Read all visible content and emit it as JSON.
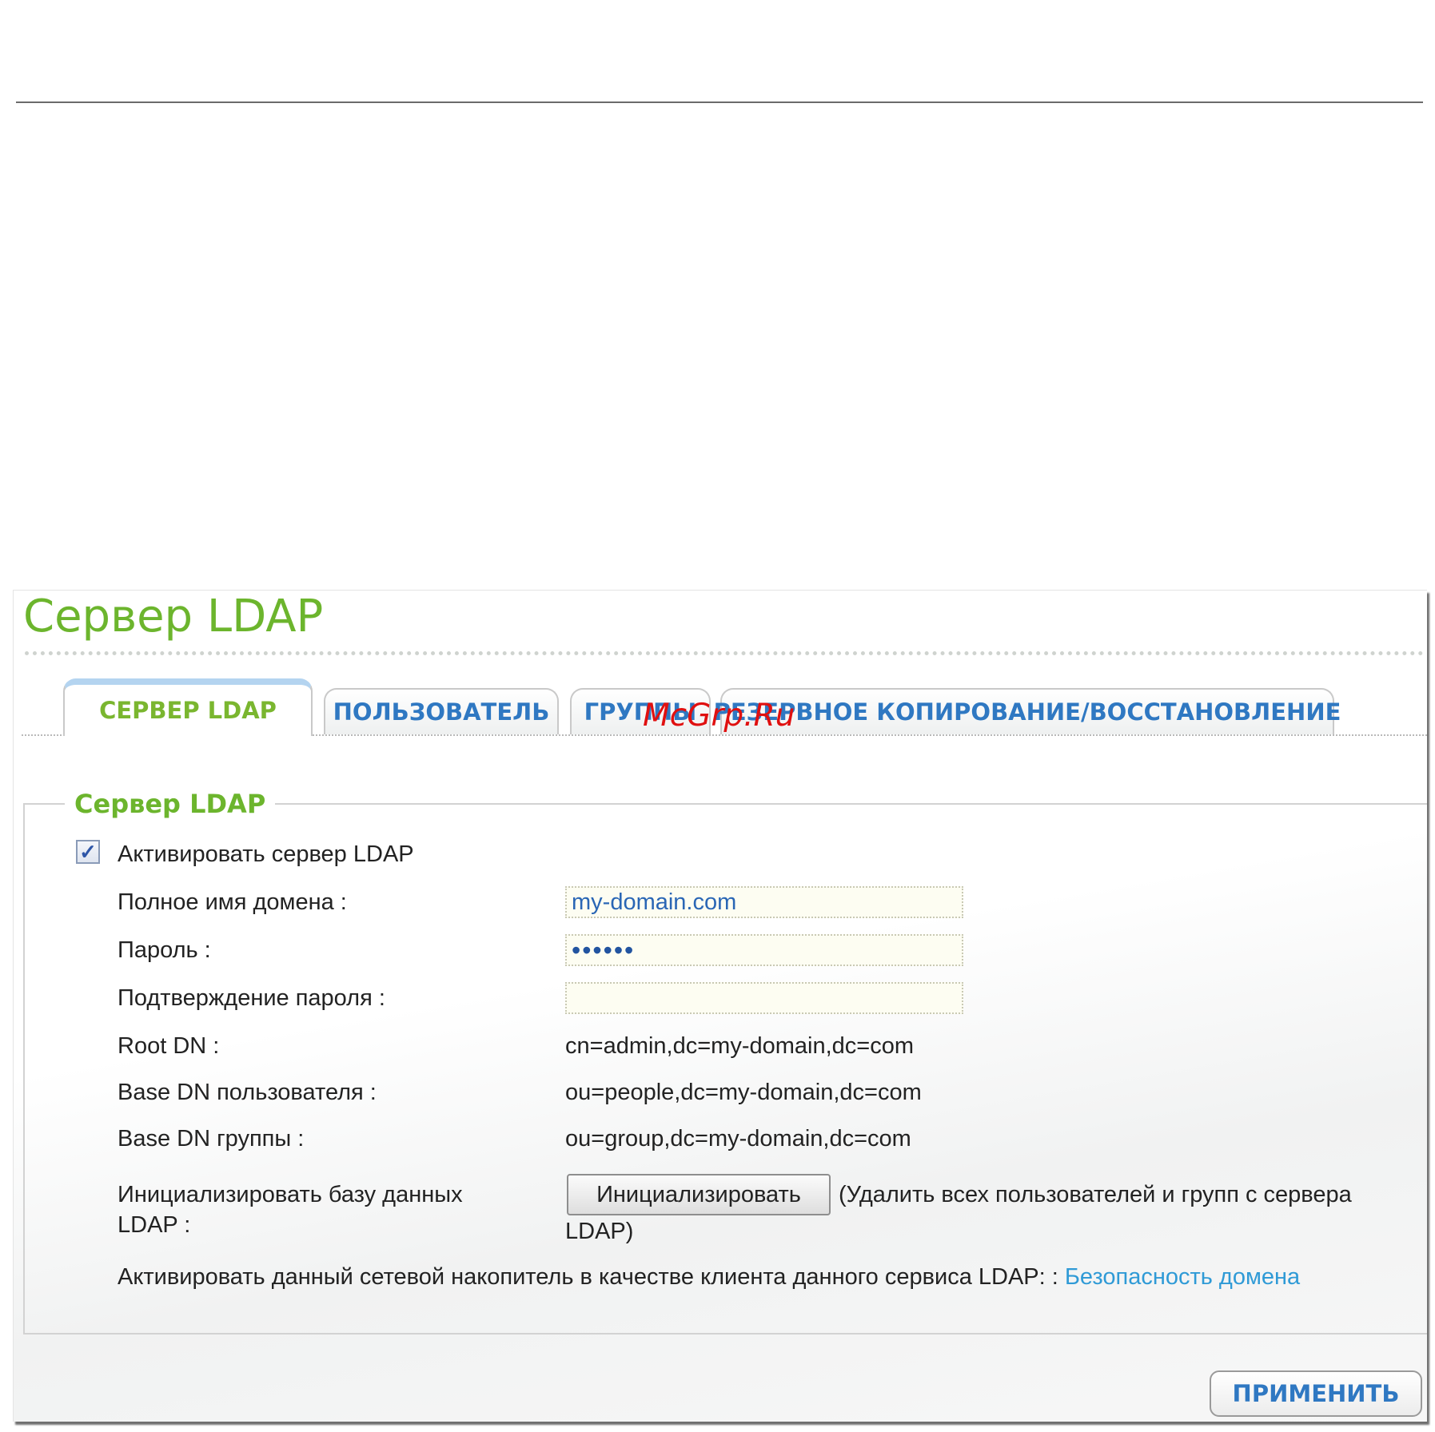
{
  "page": {
    "title": "Сервер LDAP",
    "watermark": "McGrp.Ru"
  },
  "tabs": [
    {
      "label": "СЕРВЕР LDAP",
      "active": true
    },
    {
      "label": "ПОЛЬЗОВАТЕЛЬ",
      "active": false
    },
    {
      "label": "ГРУППЫ",
      "active": false
    },
    {
      "label": "РЕЗЕРВНОЕ КОПИРОВАНИЕ/ВОССТАНОВЛЕНИЕ",
      "active": false
    }
  ],
  "section": {
    "legend": "Сервер LDAP",
    "enable_label": "Активировать сервер LDAP",
    "enable_checked": true,
    "domain_label": "Полное имя домена :",
    "domain_value": "my-domain.com",
    "password_label": "Пароль :",
    "password_value": "••••••",
    "confirm_label": "Подтверждение пароля :",
    "confirm_value": "",
    "rootdn_label": "Root DN :",
    "rootdn_value": "cn=admin,dc=my-domain,dc=com",
    "userdn_label": "Base DN пользователя :",
    "userdn_value": "ou=people,dc=my-domain,dc=com",
    "groupdn_label": "Base DN группы :",
    "groupdn_value": "ou=group,dc=my-domain,dc=com",
    "init_label_line1": "Инициализировать базу данных",
    "init_label_line2": "LDAP :",
    "init_button": "Инициализировать",
    "init_note_line1": "(Удалить всех пользователей и групп с сервера",
    "init_note_line2": "LDAP)",
    "client_text": "Активировать данный сетевой накопитель в качестве клиента данного сервиса LDAP: : ",
    "client_link": "Безопасность домена"
  },
  "footer": {
    "apply_button": "ПРИМЕНИТЬ"
  },
  "colors": {
    "accent_green": "#6cb52d",
    "tab_blue": "#2f78c2",
    "link_blue": "#2f9ad6"
  }
}
